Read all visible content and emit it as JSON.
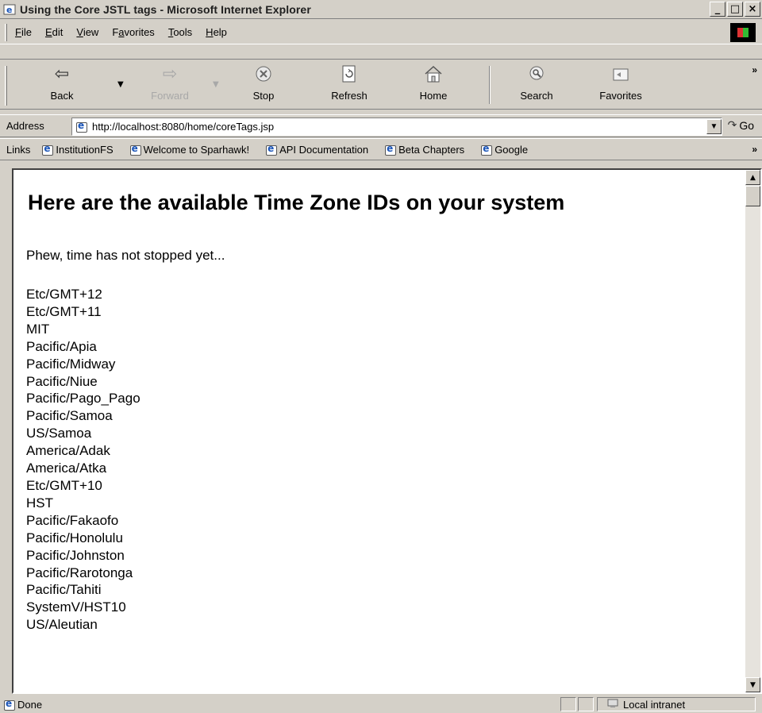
{
  "window": {
    "title": "Using the Core JSTL tags - Microsoft Internet Explorer",
    "buttons": {
      "minimize": "_",
      "maximize": "□",
      "close": "×"
    }
  },
  "menu": [
    "File",
    "Edit",
    "View",
    "Favorites",
    "Tools",
    "Help"
  ],
  "menu_access": [
    "F",
    "E",
    "V",
    "a",
    "T",
    "H"
  ],
  "toolbar": {
    "back": "Back",
    "forward": "Forward",
    "stop": "Stop",
    "refresh": "Refresh",
    "home": "Home",
    "search": "Search",
    "favorites": "Favorites",
    "more": "»"
  },
  "address": {
    "label": "Address",
    "url": "http://localhost:8080/home/coreTags.jsp",
    "go": "Go"
  },
  "links": {
    "label": "Links",
    "items": [
      "InstitutionFS",
      "Welcome to Sparhawk!",
      "API Documentation",
      "Beta Chapters",
      "Google"
    ],
    "more": "»"
  },
  "page": {
    "heading": "Here are the available Time Zone IDs on your system",
    "intro": "Phew, time has not stopped yet...",
    "zones": [
      "Etc/GMT+12",
      "Etc/GMT+11",
      "MIT",
      "Pacific/Apia",
      "Pacific/Midway",
      "Pacific/Niue",
      "Pacific/Pago_Pago",
      "Pacific/Samoa",
      "US/Samoa",
      "America/Adak",
      "America/Atka",
      "Etc/GMT+10",
      "HST",
      "Pacific/Fakaofo",
      "Pacific/Honolulu",
      "Pacific/Johnston",
      "Pacific/Rarotonga",
      "Pacific/Tahiti",
      "SystemV/HST10",
      "US/Aleutian"
    ]
  },
  "status": {
    "text": "Done",
    "zone": "Local intranet"
  }
}
